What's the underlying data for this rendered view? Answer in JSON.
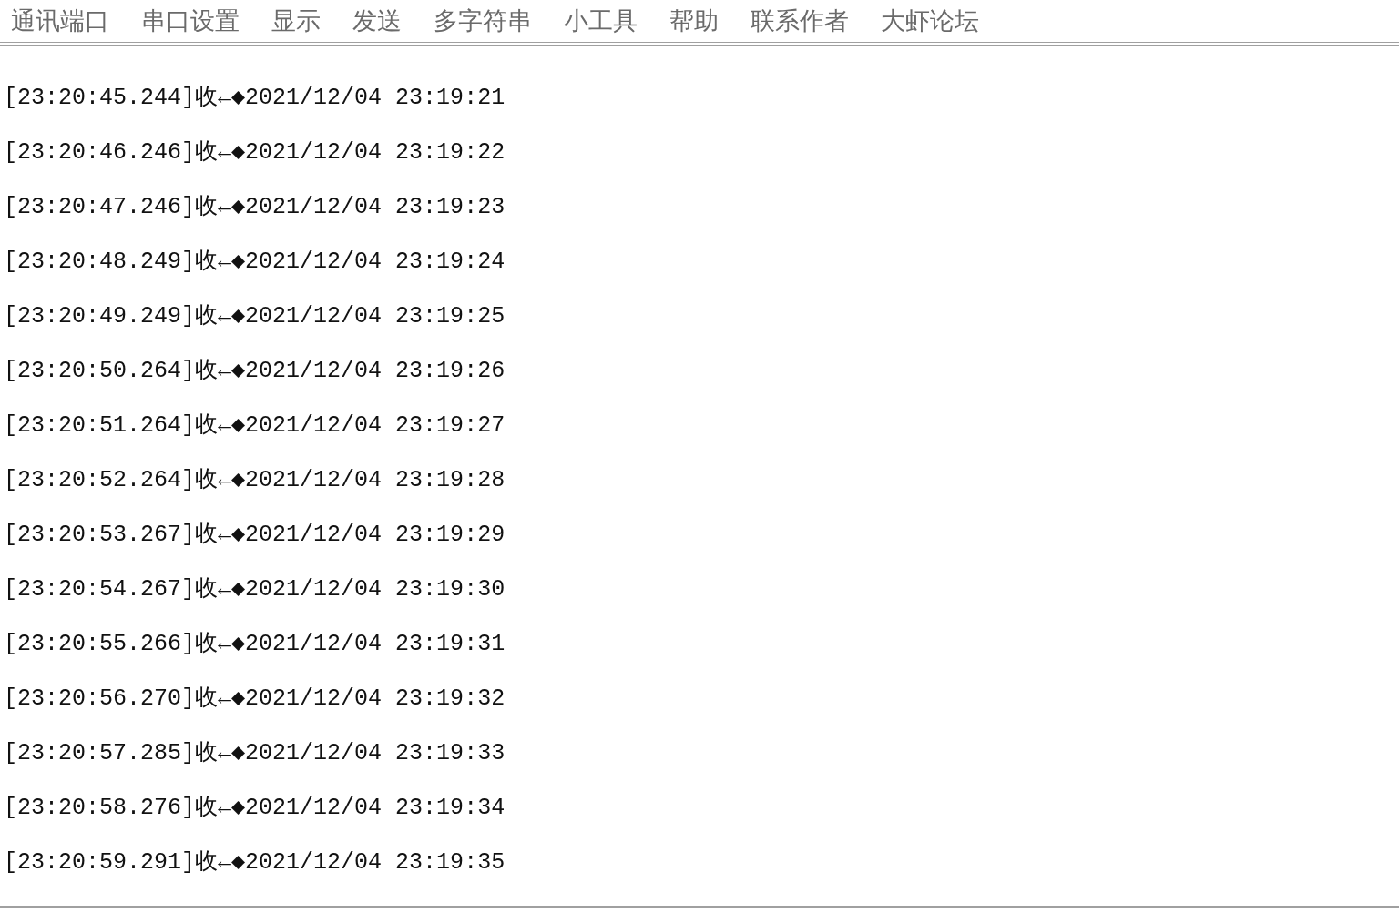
{
  "menu": [
    "通讯端口",
    "串口设置",
    "显示",
    "发送",
    "多字符串",
    "小工具",
    "帮助",
    "联系作者",
    "大虾论坛"
  ],
  "log": [
    "[23:20:45.244]收←◆2021/12/04 23:19:21",
    "[23:20:46.246]收←◆2021/12/04 23:19:22",
    "[23:20:47.246]收←◆2021/12/04 23:19:23",
    "[23:20:48.249]收←◆2021/12/04 23:19:24",
    "[23:20:49.249]收←◆2021/12/04 23:19:25",
    "[23:20:50.264]收←◆2021/12/04 23:19:26",
    "[23:20:51.264]收←◆2021/12/04 23:19:27",
    "[23:20:52.264]收←◆2021/12/04 23:19:28",
    "[23:20:53.267]收←◆2021/12/04 23:19:29",
    "[23:20:54.267]收←◆2021/12/04 23:19:30",
    "[23:20:55.266]收←◆2021/12/04 23:19:31",
    "[23:20:56.270]收←◆2021/12/04 23:19:32",
    "[23:20:57.285]收←◆2021/12/04 23:19:33",
    "[23:20:58.276]收←◆2021/12/04 23:19:34",
    "[23:20:59.291]收←◆2021/12/04 23:19:35"
  ]
}
